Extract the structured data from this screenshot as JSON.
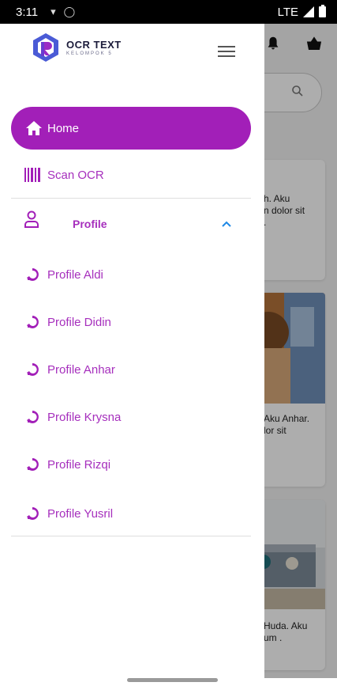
{
  "status_bar": {
    "time": "3:11",
    "network": "LTE",
    "icons": [
      "wifi-icon",
      "sync-icon",
      "signal-icon",
      "battery-icon"
    ]
  },
  "background": {
    "card1_text": "h. Aku\nn dolor sit\n.",
    "card2_text": "Aku Anhar.\nlor sit",
    "card3_text": "Huda. Aku\num .",
    "icons": [
      "bell-icon",
      "basket-icon",
      "search-icon"
    ]
  },
  "drawer": {
    "logo": {
      "title": "OCR TEXT",
      "subtitle": "KELOMPOK 5"
    },
    "accent_color": "#a21fb8",
    "items": {
      "home": "Home",
      "scan": "Scan OCR",
      "profile": "Profile"
    },
    "profiles": [
      "Profile Aldi",
      "Profile Didin",
      "Profile Anhar",
      "Profile Krysna",
      "Profile Rizqi",
      "Profile Yusril"
    ]
  }
}
